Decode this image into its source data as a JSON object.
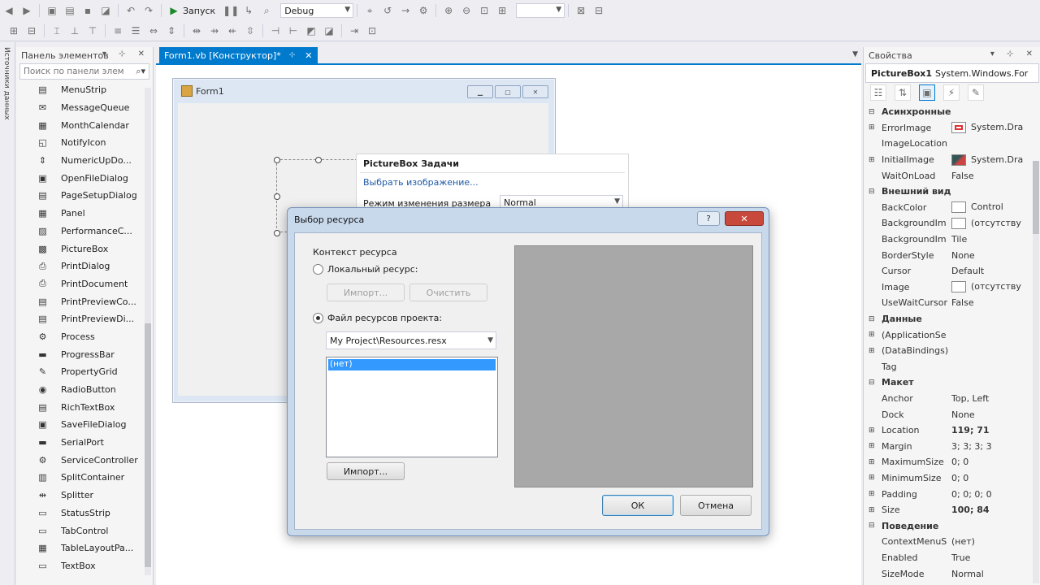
{
  "toolbar": {
    "run_label": "Запуск",
    "config_value": "Debug"
  },
  "side_strip": {
    "label": "Источники данных"
  },
  "toolbox": {
    "title": "Панель элементов",
    "search_placeholder": "Поиск по панели элем",
    "items": [
      {
        "label": "MenuStrip",
        "icon": "menustrip-icon",
        "glyph": "▤"
      },
      {
        "label": "MessageQueue",
        "icon": "messagequeue-icon",
        "glyph": "✉"
      },
      {
        "label": "MonthCalendar",
        "icon": "calendar-icon",
        "glyph": "▦"
      },
      {
        "label": "NotifyIcon",
        "icon": "notifyicon-icon",
        "glyph": "◱"
      },
      {
        "label": "NumericUpDo...",
        "icon": "numericupdown-icon",
        "glyph": "⇕"
      },
      {
        "label": "OpenFileDialog",
        "icon": "openfile-icon",
        "glyph": "▣"
      },
      {
        "label": "PageSetupDialog",
        "icon": "pagesetup-icon",
        "glyph": "▤"
      },
      {
        "label": "Panel",
        "icon": "panel-icon",
        "glyph": "▦"
      },
      {
        "label": "PerformanceC...",
        "icon": "performance-icon",
        "glyph": "▨"
      },
      {
        "label": "PictureBox",
        "icon": "picturebox-icon",
        "glyph": "▩"
      },
      {
        "label": "PrintDialog",
        "icon": "printdialog-icon",
        "glyph": "⎙"
      },
      {
        "label": "PrintDocument",
        "icon": "printdocument-icon",
        "glyph": "⎙"
      },
      {
        "label": "PrintPreviewCo...",
        "icon": "printpreviewcontrol-icon",
        "glyph": "▤"
      },
      {
        "label": "PrintPreviewDi...",
        "icon": "printpreviewdialog-icon",
        "glyph": "▤"
      },
      {
        "label": "Process",
        "icon": "process-icon",
        "glyph": "⚙"
      },
      {
        "label": "ProgressBar",
        "icon": "progressbar-icon",
        "glyph": "▬"
      },
      {
        "label": "PropertyGrid",
        "icon": "propertygrid-icon",
        "glyph": "✎"
      },
      {
        "label": "RadioButton",
        "icon": "radiobutton-icon",
        "glyph": "◉"
      },
      {
        "label": "RichTextBox",
        "icon": "richtextbox-icon",
        "glyph": "▤"
      },
      {
        "label": "SaveFileDialog",
        "icon": "savefile-icon",
        "glyph": "▣"
      },
      {
        "label": "SerialPort",
        "icon": "serialport-icon",
        "glyph": "▬"
      },
      {
        "label": "ServiceController",
        "icon": "servicecontroller-icon",
        "glyph": "⚙"
      },
      {
        "label": "SplitContainer",
        "icon": "splitcontainer-icon",
        "glyph": "▥"
      },
      {
        "label": "Splitter",
        "icon": "splitter-icon",
        "glyph": "⇹"
      },
      {
        "label": "StatusStrip",
        "icon": "statusstrip-icon",
        "glyph": "▭"
      },
      {
        "label": "TabControl",
        "icon": "tabcontrol-icon",
        "glyph": "▭"
      },
      {
        "label": "TableLayoutPa...",
        "icon": "tablelayout-icon",
        "glyph": "▦"
      },
      {
        "label": "TextBox",
        "icon": "textbox-icon",
        "glyph": "▭"
      }
    ]
  },
  "document": {
    "tab_label": "Form1.vb [Конструктор]*"
  },
  "form": {
    "title": "Form1"
  },
  "smart_tag": {
    "title": "PictureBox Задачи",
    "choose_image_link": "Выбрать изображение...",
    "size_mode_label": "Режим изменения размера",
    "size_mode_value": "Normal"
  },
  "dialog": {
    "title": "Выбор ресурса",
    "help_label": "?",
    "close_label": "✕",
    "context_label": "Контекст ресурса",
    "local_resource_label": "Локальный ресурс:",
    "import_local_label": "Импорт...",
    "clear_label": "Очистить",
    "project_file_label": "Файл ресурсов проекта:",
    "project_file_value": "My Project\\Resources.resx",
    "list_selected": "(нет)",
    "import_label": "Импорт...",
    "ok_label": "ОК",
    "cancel_label": "Отмена"
  },
  "properties": {
    "title": "Свойства",
    "object_name": "PictureBox1",
    "object_type": "System.Windows.For",
    "rows": [
      {
        "kind": "cat",
        "name": "Асинхронные",
        "expander": "⊟"
      },
      {
        "kind": "prop",
        "name": "ErrorImage",
        "value": "System.Dra",
        "expander": "⊞",
        "swatch": "error"
      },
      {
        "kind": "prop",
        "name": "ImageLocation",
        "value": ""
      },
      {
        "kind": "prop",
        "name": "InitialImage",
        "value": "System.Dra",
        "expander": "⊞",
        "swatch": "image"
      },
      {
        "kind": "prop",
        "name": "WaitOnLoad",
        "value": "False"
      },
      {
        "kind": "cat",
        "name": "Внешний вид",
        "expander": "⊟"
      },
      {
        "kind": "prop",
        "name": "BackColor",
        "value": "Control",
        "swatch": "blank"
      },
      {
        "kind": "prop",
        "name": "BackgroundIm",
        "value": "(отсутству",
        "swatch": "blank"
      },
      {
        "kind": "prop",
        "name": "BackgroundIm",
        "value": "Tile"
      },
      {
        "kind": "prop",
        "name": "BorderStyle",
        "value": "None"
      },
      {
        "kind": "prop",
        "name": "Cursor",
        "value": "Default"
      },
      {
        "kind": "prop",
        "name": "Image",
        "value": "(отсутству",
        "swatch": "blank"
      },
      {
        "kind": "prop",
        "name": "UseWaitCursor",
        "value": "False"
      },
      {
        "kind": "cat",
        "name": "Данные",
        "expander": "⊟"
      },
      {
        "kind": "prop",
        "name": "(ApplicationSe",
        "value": "",
        "expander": "⊞"
      },
      {
        "kind": "prop",
        "name": "(DataBindings)",
        "value": "",
        "expander": "⊞"
      },
      {
        "kind": "prop",
        "name": "Tag",
        "value": ""
      },
      {
        "kind": "cat",
        "name": "Макет",
        "expander": "⊟"
      },
      {
        "kind": "prop",
        "name": "Anchor",
        "value": "Top, Left"
      },
      {
        "kind": "prop",
        "name": "Dock",
        "value": "None"
      },
      {
        "kind": "prop",
        "name": "Location",
        "value": "119; 71",
        "expander": "⊞",
        "bold": true
      },
      {
        "kind": "prop",
        "name": "Margin",
        "value": "3; 3; 3; 3",
        "expander": "⊞"
      },
      {
        "kind": "prop",
        "name": "MaximumSize",
        "value": "0; 0",
        "expander": "⊞"
      },
      {
        "kind": "prop",
        "name": "MinimumSize",
        "value": "0; 0",
        "expander": "⊞"
      },
      {
        "kind": "prop",
        "name": "Padding",
        "value": "0; 0; 0; 0",
        "expander": "⊞"
      },
      {
        "kind": "prop",
        "name": "Size",
        "value": "100; 84",
        "expander": "⊞",
        "bold": true
      },
      {
        "kind": "cat",
        "name": "Поведение",
        "expander": "⊟"
      },
      {
        "kind": "prop",
        "name": "ContextMenuS",
        "value": "(нет)"
      },
      {
        "kind": "prop",
        "name": "Enabled",
        "value": "True"
      },
      {
        "kind": "prop",
        "name": "SizeMode",
        "value": "Normal"
      }
    ]
  },
  "colors": {
    "accent": "#007acc",
    "selection": "#3399ff",
    "close_red": "#c8493b",
    "preview_gray": "#a8a8a8"
  }
}
